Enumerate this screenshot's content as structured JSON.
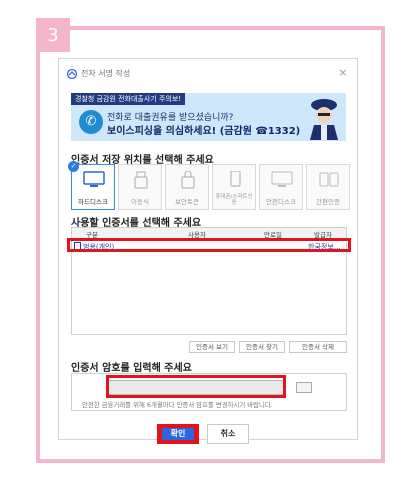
{
  "step": {
    "number": "3"
  },
  "dialog": {
    "title": "전자 서명 작성",
    "close_glyph": "×"
  },
  "banner": {
    "tag": "경찰청 금감원 전화대출사기 주의보!",
    "line1": "전화로 대출권유를 받으셨습니까?",
    "line2": "보이스피싱을 의심하세요! (금감원 ☎1332)"
  },
  "storage": {
    "title": "인증서 저장 위치를 선택해 주세요",
    "items": [
      {
        "label": "하드디스크",
        "icon": "hard-disk-icon",
        "selected": true
      },
      {
        "label": "이동식",
        "icon": "usb-icon",
        "selected": false
      },
      {
        "label": "보안토큰",
        "icon": "security-token-icon",
        "selected": false
      },
      {
        "label": "휴대폰/스마트인증",
        "icon": "mobile-phone-icon",
        "selected": false
      },
      {
        "label": "안전디스크",
        "icon": "safe-disk-icon",
        "selected": false
      },
      {
        "label": "간편인증",
        "icon": "simple-auth-icon",
        "selected": false
      }
    ]
  },
  "certificate": {
    "title": "사용할 인증서를 선택해 주세요",
    "columns": [
      "구분",
      "사용자",
      "만료일",
      "발급자"
    ],
    "rows": [
      {
        "type": "범용(개인)",
        "user": "",
        "expiry": "",
        "issuer": "한국정보…"
      }
    ],
    "buttons": [
      "인증서 보기",
      "인증서 찾기",
      "인증서 삭제"
    ]
  },
  "password": {
    "title": "인증서 암호를 입력해 주세요",
    "value": "",
    "note": "안전한 금융거래를 위해 6개월마다 인증서 암호를 변경하시기 바랍니다."
  },
  "actions": {
    "ok_label": "확인",
    "cancel_label": "취소"
  },
  "colors": {
    "frame": "#f4b6c9",
    "highlight": "#e0141e",
    "primary": "#2b66e0",
    "banner_bg": "#cfe7fb"
  }
}
